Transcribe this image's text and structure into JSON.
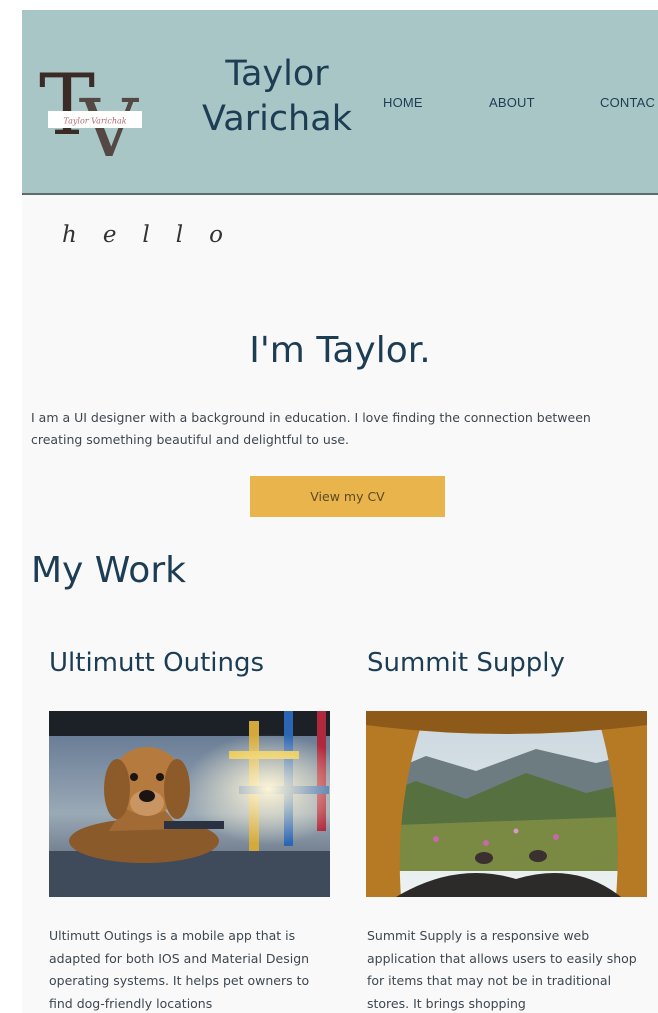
{
  "header": {
    "logo_letters": "TV",
    "logo_signature": "Taylor Varichak",
    "name_line1": "Taylor",
    "name_line2": "Varichak",
    "nav": [
      "HOME",
      "ABOUT",
      "CONTAC"
    ]
  },
  "greeting": "hello",
  "hero": {
    "title": "I'm Taylor.",
    "description": "I am a UI designer with a background in education. I love finding the connection between creating something beautiful and delightful to use.",
    "cta_label": "View my CV"
  },
  "work": {
    "title": "My Work",
    "projects": [
      {
        "name": "Ultimutt Outings",
        "image": "puppy-photo",
        "description": "Ultimutt Outings is a mobile app that is adapted for both IOS and Material Design operating systems. It helps pet owners to find dog-friendly locations"
      },
      {
        "name": "Summit Supply",
        "image": "mountain-tent-photo",
        "description": "Summit Supply is a responsive web application that allows users to easily shop for items that may not be in traditional stores. It brings shopping"
      }
    ]
  },
  "colors": {
    "header_bg": "#a8c6c6",
    "heading": "#1d3d55",
    "accent": "#e9b44c",
    "page_bg": "#f9f9f9"
  }
}
